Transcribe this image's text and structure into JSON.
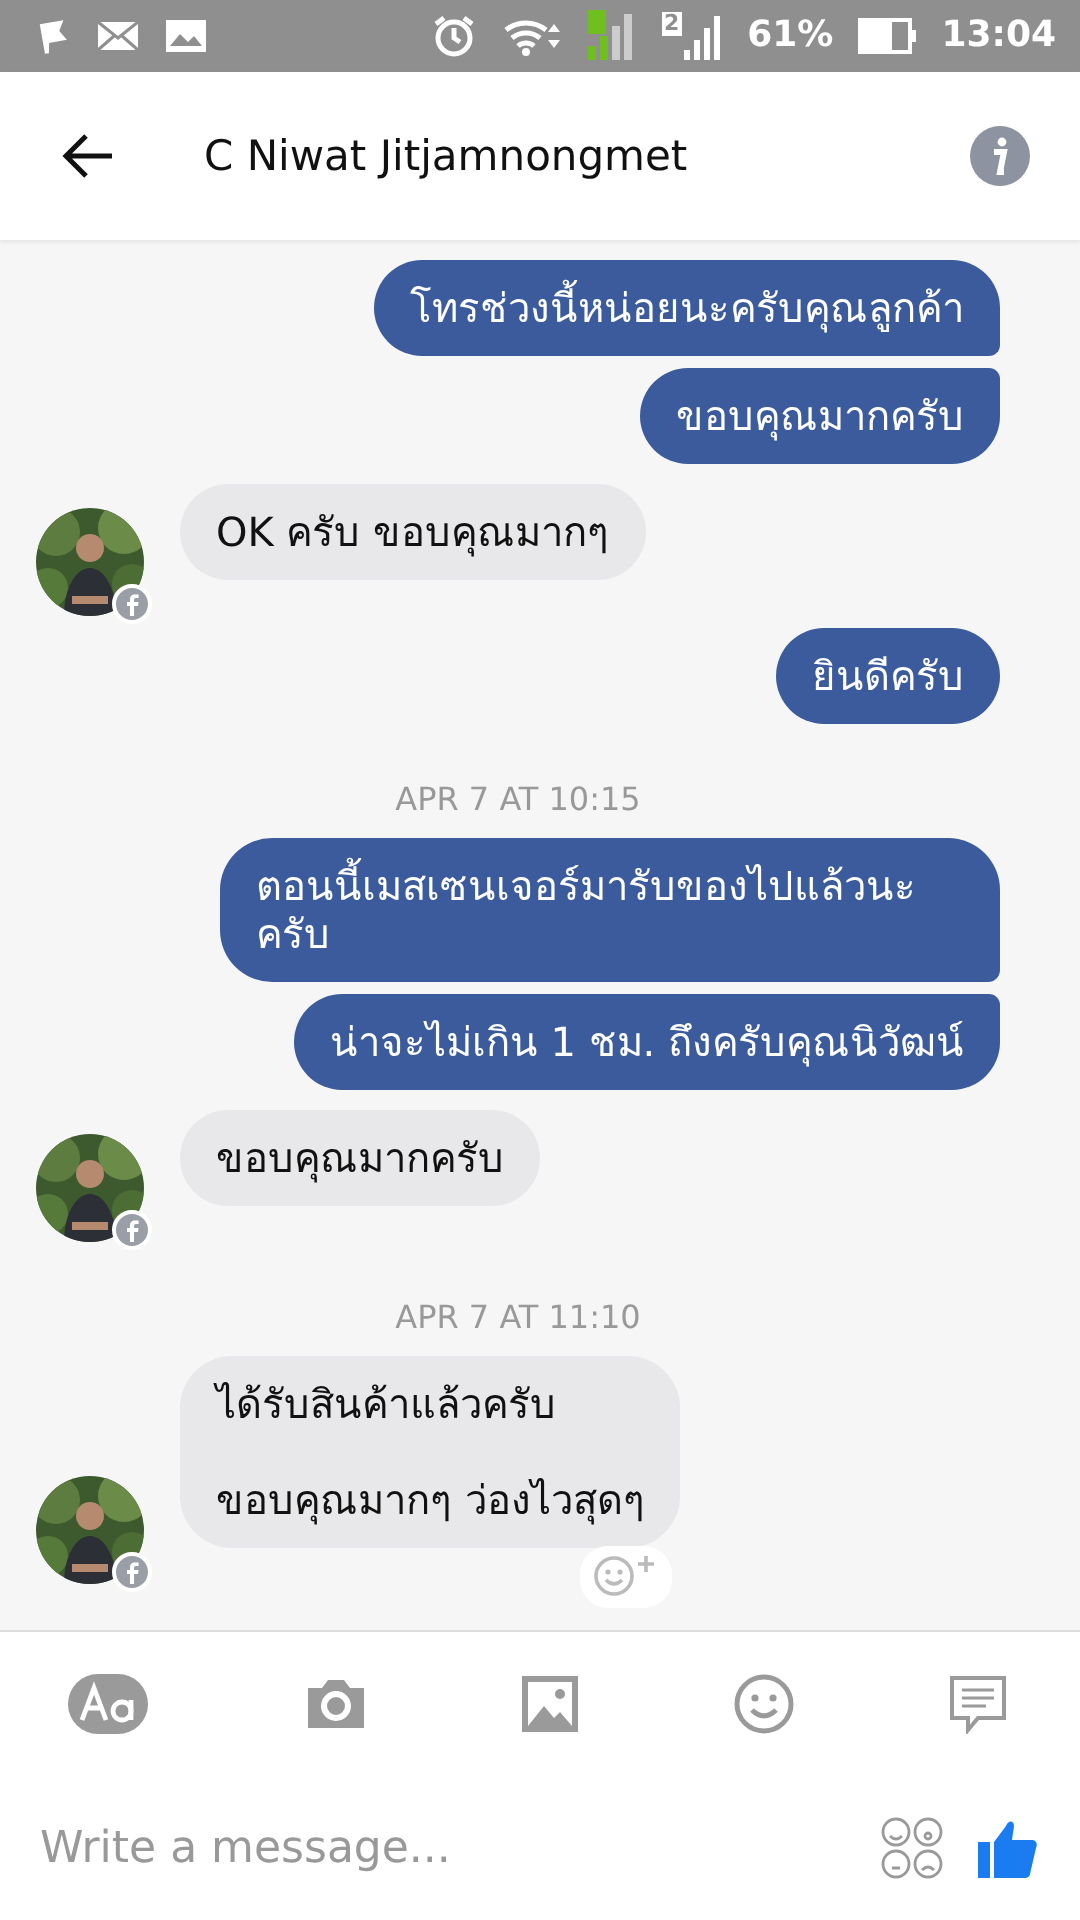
{
  "status_bar": {
    "sim2_label": "2",
    "battery": "61%",
    "time": "13:04"
  },
  "header": {
    "title": "C Niwat Jitjamnongmet"
  },
  "messages": [
    {
      "kind": "outgoing",
      "text": "โทรช่วงนี้หน่อยนะครับคุณลูกค้า"
    },
    {
      "kind": "outgoing",
      "text": "ขอบคุณมากครับ"
    },
    {
      "kind": "incoming",
      "text": "OK ครับ ขอบคุณมากๆ"
    },
    {
      "kind": "outgoing",
      "text": "ยินดีครับ"
    },
    {
      "kind": "timestamp",
      "text": "APR 7 AT 10:15"
    },
    {
      "kind": "outgoing",
      "text": "ตอนนี้เมสเซนเจอร์มารับของไปแล้วนะครับ"
    },
    {
      "kind": "outgoing",
      "text": "น่าจะไม่เกิน 1 ชม. ถึงครับคุณนิวัฒน์"
    },
    {
      "kind": "incoming",
      "text": "ขอบคุณมากครับ"
    },
    {
      "kind": "timestamp",
      "text": "APR 7 AT 11:10"
    },
    {
      "kind": "incoming",
      "text": "ได้รับสินค้าแล้วครับ\n\nขอบคุณมากๆ ว่องไวสุดๆ",
      "reaction_button": true
    }
  ],
  "composer": {
    "placeholder": "Write a message..."
  }
}
